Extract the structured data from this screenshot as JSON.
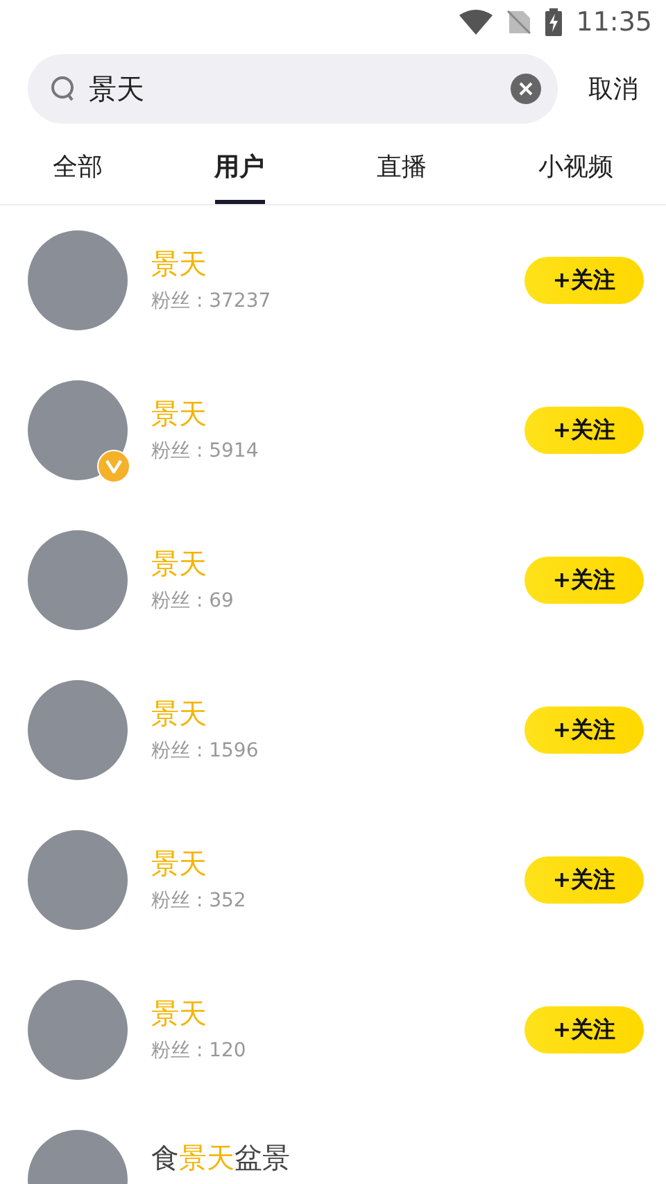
{
  "status_bar": {
    "time": "11:35"
  },
  "search": {
    "value": "景天",
    "cancel": "取消"
  },
  "tabs": [
    {
      "label": "全部",
      "selected": false
    },
    {
      "label": "用户",
      "selected": true
    },
    {
      "label": "直播",
      "selected": false
    },
    {
      "label": "小视频",
      "selected": false
    }
  ],
  "users": [
    {
      "name": [
        {
          "text": "景天",
          "highlight": true
        }
      ],
      "fans": "粉丝 : 37237",
      "verified": false,
      "follow": "+关注"
    },
    {
      "name": [
        {
          "text": "景天",
          "highlight": true
        }
      ],
      "fans": "粉丝 : 5914",
      "verified": true,
      "follow": "+关注"
    },
    {
      "name": [
        {
          "text": "景天",
          "highlight": true
        }
      ],
      "fans": "粉丝 : 69",
      "verified": false,
      "follow": "+关注"
    },
    {
      "name": [
        {
          "text": "景天",
          "highlight": true
        }
      ],
      "fans": "粉丝 : 1596",
      "verified": false,
      "follow": "+关注"
    },
    {
      "name": [
        {
          "text": "景天",
          "highlight": true
        }
      ],
      "fans": "粉丝 : 352",
      "verified": false,
      "follow": "+关注"
    },
    {
      "name": [
        {
          "text": "景天",
          "highlight": true
        }
      ],
      "fans": "粉丝 : 120",
      "verified": false,
      "follow": "+关注"
    },
    {
      "name": [
        {
          "text": "食",
          "highlight": false
        },
        {
          "text": "景天",
          "highlight": true
        },
        {
          "text": "盆景",
          "highlight": false
        }
      ],
      "verified": false
    }
  ]
}
